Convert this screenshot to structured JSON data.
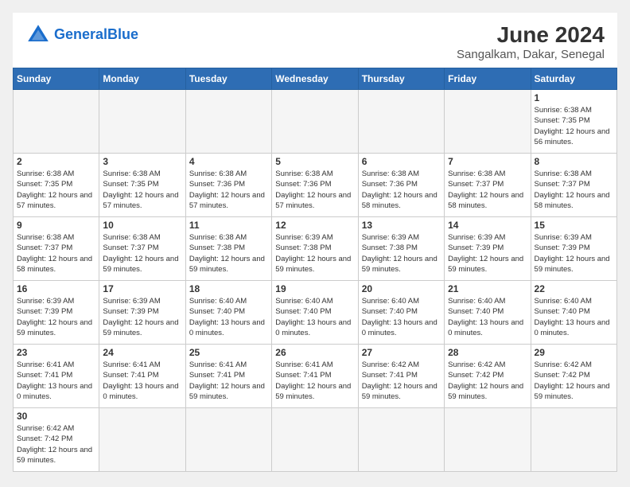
{
  "header": {
    "logo_general": "General",
    "logo_blue": "Blue",
    "month_title": "June 2024",
    "location": "Sangalkam, Dakar, Senegal"
  },
  "days_of_week": [
    "Sunday",
    "Monday",
    "Tuesday",
    "Wednesday",
    "Thursday",
    "Friday",
    "Saturday"
  ],
  "weeks": [
    [
      {
        "day": "",
        "info": ""
      },
      {
        "day": "",
        "info": ""
      },
      {
        "day": "",
        "info": ""
      },
      {
        "day": "",
        "info": ""
      },
      {
        "day": "",
        "info": ""
      },
      {
        "day": "",
        "info": ""
      },
      {
        "day": "1",
        "info": "Sunrise: 6:38 AM\nSunset: 7:35 PM\nDaylight: 12 hours\nand 56 minutes."
      }
    ],
    [
      {
        "day": "2",
        "info": "Sunrise: 6:38 AM\nSunset: 7:35 PM\nDaylight: 12 hours\nand 57 minutes."
      },
      {
        "day": "3",
        "info": "Sunrise: 6:38 AM\nSunset: 7:35 PM\nDaylight: 12 hours\nand 57 minutes."
      },
      {
        "day": "4",
        "info": "Sunrise: 6:38 AM\nSunset: 7:36 PM\nDaylight: 12 hours\nand 57 minutes."
      },
      {
        "day": "5",
        "info": "Sunrise: 6:38 AM\nSunset: 7:36 PM\nDaylight: 12 hours\nand 57 minutes."
      },
      {
        "day": "6",
        "info": "Sunrise: 6:38 AM\nSunset: 7:36 PM\nDaylight: 12 hours\nand 58 minutes."
      },
      {
        "day": "7",
        "info": "Sunrise: 6:38 AM\nSunset: 7:37 PM\nDaylight: 12 hours\nand 58 minutes."
      },
      {
        "day": "8",
        "info": "Sunrise: 6:38 AM\nSunset: 7:37 PM\nDaylight: 12 hours\nand 58 minutes."
      }
    ],
    [
      {
        "day": "9",
        "info": "Sunrise: 6:38 AM\nSunset: 7:37 PM\nDaylight: 12 hours\nand 58 minutes."
      },
      {
        "day": "10",
        "info": "Sunrise: 6:38 AM\nSunset: 7:37 PM\nDaylight: 12 hours\nand 59 minutes."
      },
      {
        "day": "11",
        "info": "Sunrise: 6:38 AM\nSunset: 7:38 PM\nDaylight: 12 hours\nand 59 minutes."
      },
      {
        "day": "12",
        "info": "Sunrise: 6:39 AM\nSunset: 7:38 PM\nDaylight: 12 hours\nand 59 minutes."
      },
      {
        "day": "13",
        "info": "Sunrise: 6:39 AM\nSunset: 7:38 PM\nDaylight: 12 hours\nand 59 minutes."
      },
      {
        "day": "14",
        "info": "Sunrise: 6:39 AM\nSunset: 7:39 PM\nDaylight: 12 hours\nand 59 minutes."
      },
      {
        "day": "15",
        "info": "Sunrise: 6:39 AM\nSunset: 7:39 PM\nDaylight: 12 hours\nand 59 minutes."
      }
    ],
    [
      {
        "day": "16",
        "info": "Sunrise: 6:39 AM\nSunset: 7:39 PM\nDaylight: 12 hours\nand 59 minutes."
      },
      {
        "day": "17",
        "info": "Sunrise: 6:39 AM\nSunset: 7:39 PM\nDaylight: 12 hours\nand 59 minutes."
      },
      {
        "day": "18",
        "info": "Sunrise: 6:40 AM\nSunset: 7:40 PM\nDaylight: 13 hours\nand 0 minutes."
      },
      {
        "day": "19",
        "info": "Sunrise: 6:40 AM\nSunset: 7:40 PM\nDaylight: 13 hours\nand 0 minutes."
      },
      {
        "day": "20",
        "info": "Sunrise: 6:40 AM\nSunset: 7:40 PM\nDaylight: 13 hours\nand 0 minutes."
      },
      {
        "day": "21",
        "info": "Sunrise: 6:40 AM\nSunset: 7:40 PM\nDaylight: 13 hours\nand 0 minutes."
      },
      {
        "day": "22",
        "info": "Sunrise: 6:40 AM\nSunset: 7:40 PM\nDaylight: 13 hours\nand 0 minutes."
      }
    ],
    [
      {
        "day": "23",
        "info": "Sunrise: 6:41 AM\nSunset: 7:41 PM\nDaylight: 13 hours\nand 0 minutes."
      },
      {
        "day": "24",
        "info": "Sunrise: 6:41 AM\nSunset: 7:41 PM\nDaylight: 13 hours\nand 0 minutes."
      },
      {
        "day": "25",
        "info": "Sunrise: 6:41 AM\nSunset: 7:41 PM\nDaylight: 12 hours\nand 59 minutes."
      },
      {
        "day": "26",
        "info": "Sunrise: 6:41 AM\nSunset: 7:41 PM\nDaylight: 12 hours\nand 59 minutes."
      },
      {
        "day": "27",
        "info": "Sunrise: 6:42 AM\nSunset: 7:41 PM\nDaylight: 12 hours\nand 59 minutes."
      },
      {
        "day": "28",
        "info": "Sunrise: 6:42 AM\nSunset: 7:42 PM\nDaylight: 12 hours\nand 59 minutes."
      },
      {
        "day": "29",
        "info": "Sunrise: 6:42 AM\nSunset: 7:42 PM\nDaylight: 12 hours\nand 59 minutes."
      }
    ],
    [
      {
        "day": "30",
        "info": "Sunrise: 6:42 AM\nSunset: 7:42 PM\nDaylight: 12 hours\nand 59 minutes."
      },
      {
        "day": "",
        "info": ""
      },
      {
        "day": "",
        "info": ""
      },
      {
        "day": "",
        "info": ""
      },
      {
        "day": "",
        "info": ""
      },
      {
        "day": "",
        "info": ""
      },
      {
        "day": "",
        "info": ""
      }
    ]
  ]
}
